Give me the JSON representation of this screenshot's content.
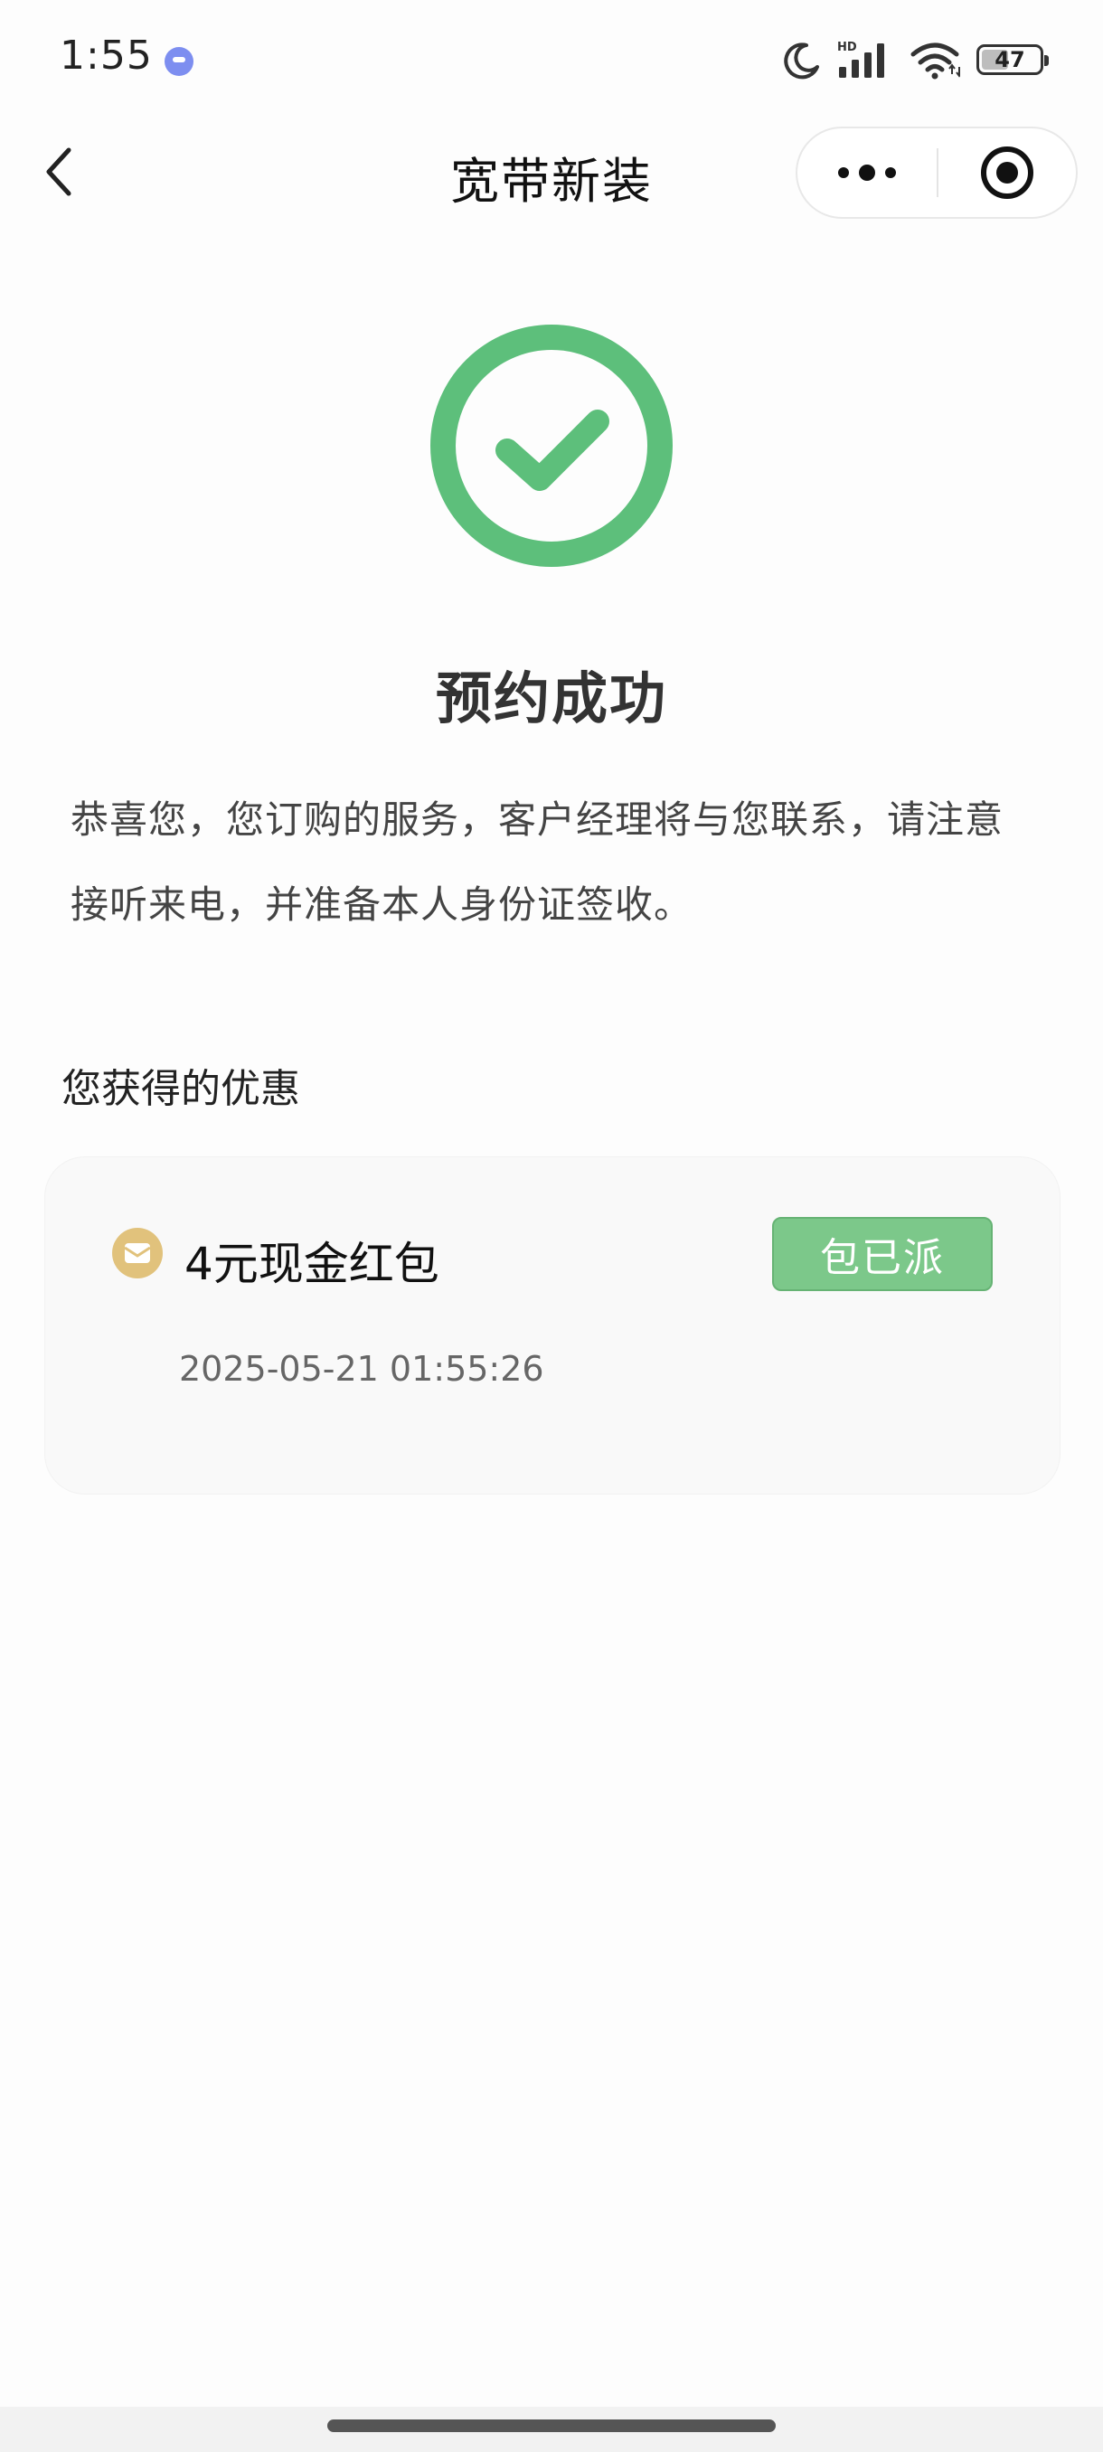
{
  "status_bar": {
    "time": "1:55",
    "battery_level": "47",
    "battery_fraction": 0.47,
    "icons": [
      "messenger-app-icon",
      "moon-icon",
      "hd-signal-icon",
      "wifi-icon",
      "battery-icon"
    ]
  },
  "nav": {
    "title": "宽带新装",
    "back_icon": "chevron-left-icon",
    "more_icon": "more-dots-icon",
    "close_icon": "target-close-icon"
  },
  "success": {
    "icon": "check-circle-icon",
    "title": "预约成功",
    "message": "恭喜您，您订购的服务，客户经理将与您联系，请注意接听来电，并准备本人身份证签收。"
  },
  "benefits": {
    "heading": "您获得的优惠",
    "items": [
      {
        "name": "4元现金红包",
        "status": "包已派",
        "time": "2025-05-21 01:55:26",
        "icon": "red-packet-icon"
      }
    ]
  },
  "colors": {
    "success_green": "#5dbf7b",
    "status_green": "#7cc88a",
    "coupon_gold": "#e1c27c",
    "card_bg": "#f9f9f9"
  }
}
